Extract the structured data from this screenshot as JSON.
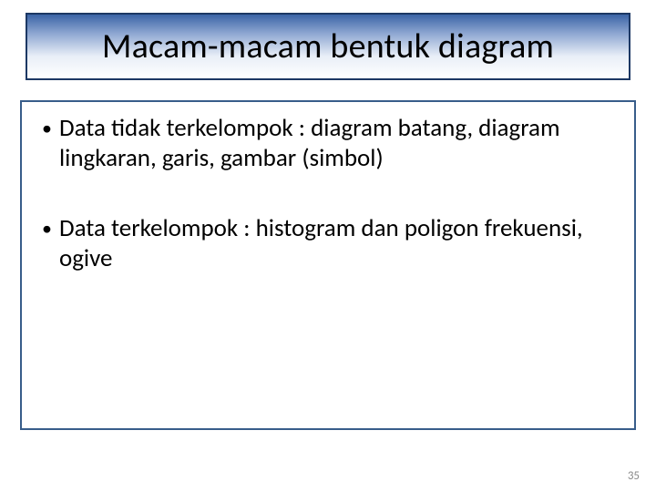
{
  "slide": {
    "title": "Macam-macam bentuk diagram",
    "bullets": [
      "Data tidak terkelompok : diagram batang, diagram lingkaran, garis, gambar (simbol)",
      "Data terkelompok : histogram dan poligon frekuensi, ogive"
    ],
    "page_number": "35"
  }
}
